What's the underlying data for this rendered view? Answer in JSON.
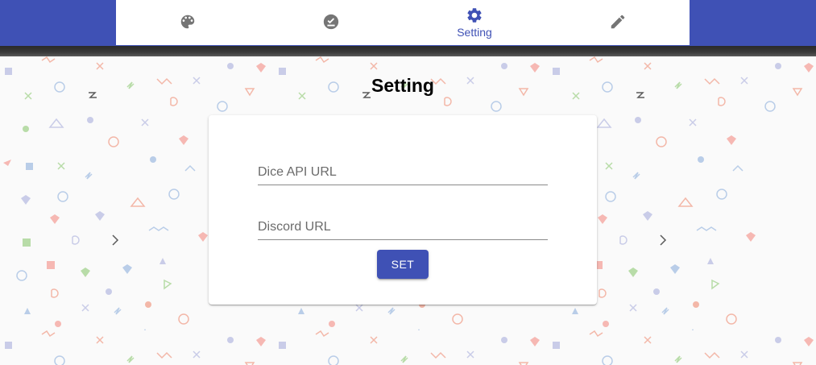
{
  "nav": {
    "items": [
      {
        "icon": "palette-icon",
        "label": ""
      },
      {
        "icon": "check-circle-icon",
        "label": ""
      },
      {
        "icon": "gear-icon",
        "label": "Setting",
        "active": true
      },
      {
        "icon": "pencil-icon",
        "label": ""
      }
    ]
  },
  "page": {
    "title": "Setting"
  },
  "form": {
    "dice_api_url": {
      "value": "",
      "placeholder": "Dice API URL"
    },
    "discord_url": {
      "value": "",
      "placeholder": "Discord URL"
    },
    "submit_label": "SET"
  },
  "colors": {
    "primary": "#3f51b5",
    "nav_inactive": "#757575",
    "background": "#fafafa",
    "card": "#ffffff"
  }
}
